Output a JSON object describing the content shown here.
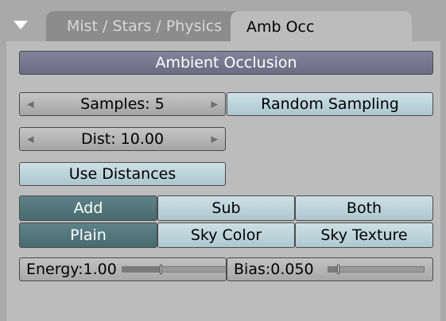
{
  "tabs": {
    "inactive_label": "Mist / Stars / Physics",
    "active_label": "Amb Occ"
  },
  "header_button": "Ambient Occlusion",
  "samples": {
    "label": "Samples: 5"
  },
  "random_sampling": "Random Sampling",
  "dist": {
    "label": "Dist: 10.00"
  },
  "use_distances": "Use Distances",
  "blend_mode": {
    "options": [
      "Add",
      "Sub",
      "Both"
    ],
    "selected": "Add"
  },
  "color_mode": {
    "options": [
      "Plain",
      "Sky Color",
      "Sky Texture"
    ],
    "selected": "Plain"
  },
  "energy": {
    "label": "Energy:1.00",
    "value": 1.0,
    "max": 3.0
  },
  "bias": {
    "label": "Bias:0.050",
    "value": 0.05,
    "max": 0.5
  },
  "icons": {
    "collapse": "triangle-down-icon"
  }
}
